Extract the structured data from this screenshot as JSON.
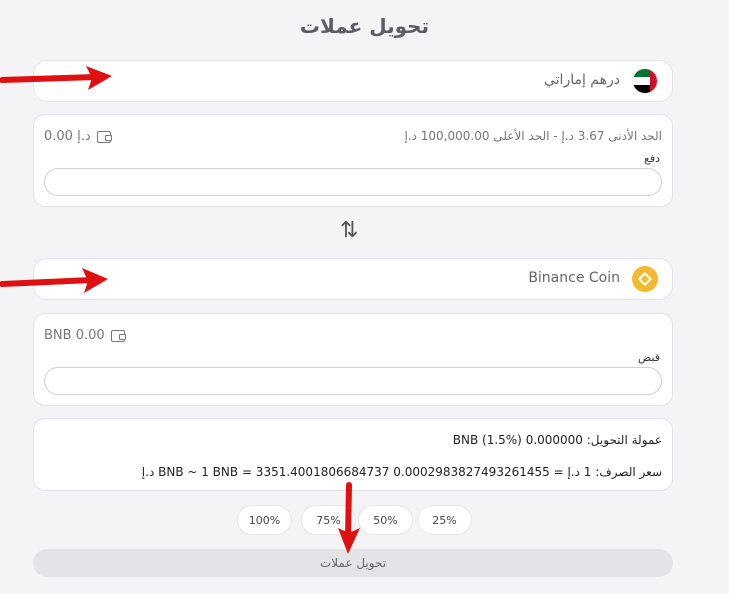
{
  "title": "تحويل عملات",
  "from": {
    "currency_label": "درهم إماراتي",
    "balance": "0.00 د.إ",
    "limits": "الحد الأدنى 3.67 د.إ   -   الحد الأعلى 100,000.00 د.إ",
    "field_label": "دفع",
    "input_value": ""
  },
  "to": {
    "currency_label": "Binance Coin",
    "balance": "BNB 0.00",
    "field_label": "قبض",
    "input_value": ""
  },
  "info": {
    "fee": "عمولة التحويل: 0.000000 BNB (1.5%)",
    "rate": "سعر الصرف: 1 د.إ = 0.0002983827493261455 BNB ~ 1 BNB = 3351.4001806684737 د.إ"
  },
  "percent_buttons": [
    "100%",
    "75%",
    "50%",
    "25%"
  ],
  "submit_label": "تحويل عملات",
  "icons": {
    "uae": "uae-flag-icon",
    "bnb": "bnb-coin-icon",
    "wallet": "wallet-icon",
    "swap": "swap-icon"
  },
  "colors": {
    "annotation_arrow": "#e01010",
    "bnb": "#f3ba2f"
  }
}
